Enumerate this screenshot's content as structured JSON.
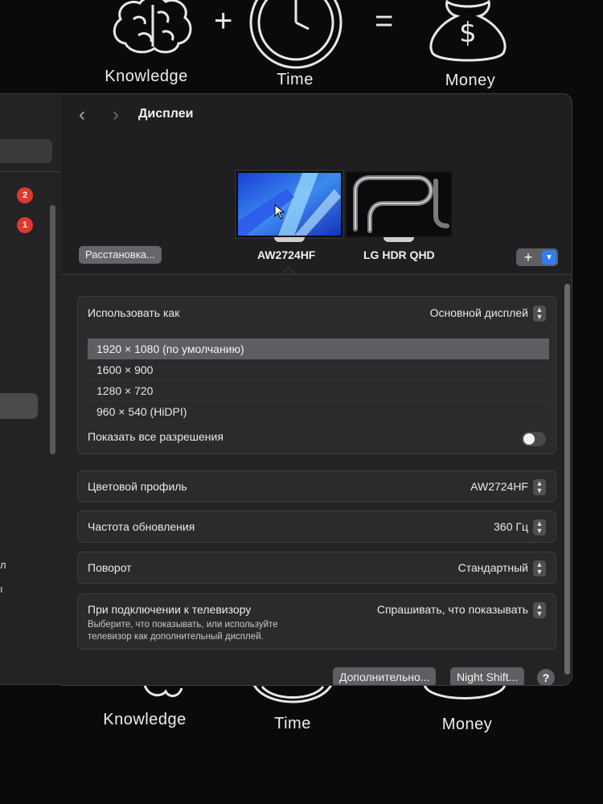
{
  "wallpaper": {
    "items": [
      "Knowledge",
      "Time",
      "Money"
    ],
    "plus": "+",
    "equals": "="
  },
  "sidebar": {
    "badges": [
      "2",
      "1"
    ],
    "fragment_1": "л",
    "fragment_2": "ı"
  },
  "window": {
    "title": "Дисплеи",
    "arrange_button": "Расстановка...",
    "displays": [
      "AW2724HF",
      "LG HDR QHD"
    ],
    "plus_label": "+"
  },
  "settings": {
    "use_as": {
      "label": "Использовать как",
      "value": "Основной дисплей"
    },
    "resolutions": [
      "1920 × 1080 (по умолчанию)",
      "1600 × 900",
      "1280 × 720",
      "960 × 540 (HiDPI)"
    ],
    "selected_resolution": "1920 × 1080 (по умолчанию)",
    "show_all": {
      "label": "Показать все разрешения",
      "enabled": false
    },
    "color_profile": {
      "label": "Цветовой профиль",
      "value": "AW2724HF"
    },
    "refresh_rate": {
      "label": "Частота обновления",
      "value": "360 Гц"
    },
    "rotation": {
      "label": "Поворот",
      "value": "Стандартный"
    },
    "tv": {
      "label": "При подключении к телевизору",
      "description_1": "Выберите, что показывать, или используйте",
      "description_2": "телевизор как дополнительный дисплей.",
      "value": "Спрашивать, что показывать"
    }
  },
  "footer": {
    "advanced_button": "Дополнительно...",
    "night_shift_button": "Night Shift...",
    "help_label": "?"
  },
  "colors": {
    "accent": "#2f7cf6",
    "badge": "#e0382d",
    "window_bg": "#1f1f21"
  },
  "icons": [
    "brain-icon",
    "clock-icon",
    "money-bag-icon",
    "back-arrow-icon",
    "forward-arrow-icon",
    "stepper-icon",
    "chevron-down-icon"
  ]
}
